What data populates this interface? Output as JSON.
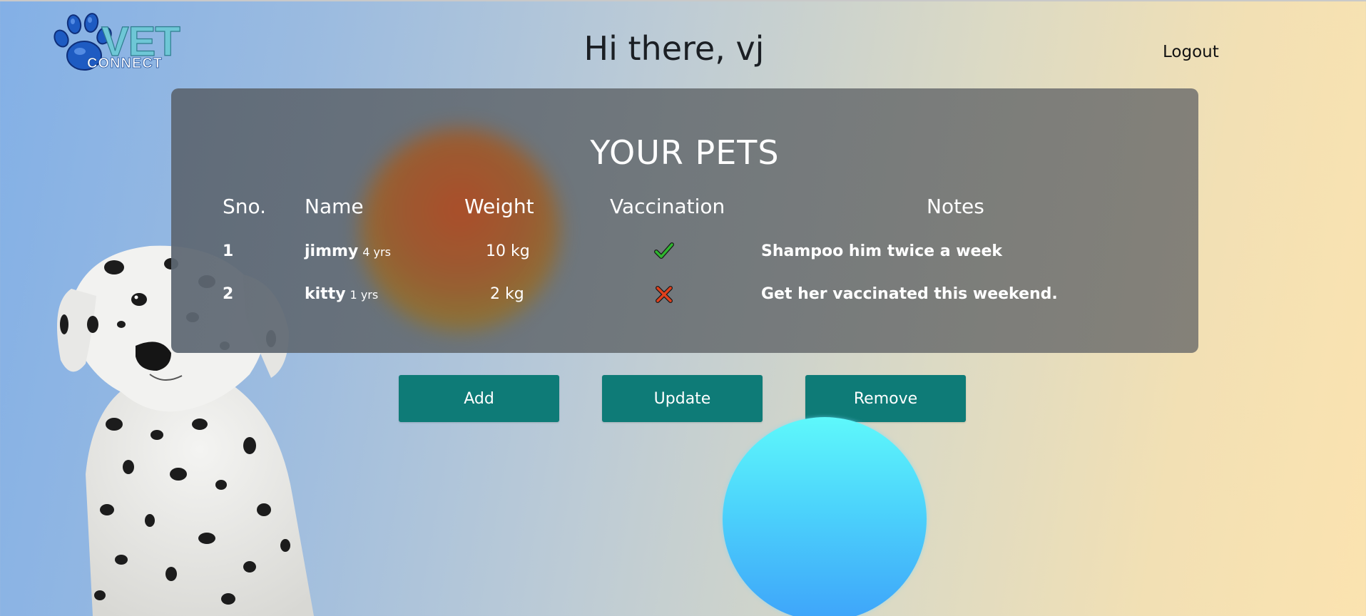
{
  "brand": {
    "logo_top": "VET",
    "logo_bottom": "CONNECT"
  },
  "header": {
    "greeting": "Hi there, vj",
    "logout_label": "Logout"
  },
  "pets_card": {
    "title": "YOUR PETS",
    "columns": [
      "Sno.",
      "Name",
      "Weight",
      "Vaccination",
      "Notes"
    ],
    "rows": [
      {
        "sno": "1",
        "name": "jimmy",
        "age": "4 yrs",
        "weight": "10 kg",
        "vaccinated": true,
        "vaccination_icon": "checkmark-icon",
        "notes": "Shampoo him twice a week"
      },
      {
        "sno": "2",
        "name": "kitty",
        "age": "1 yrs",
        "weight": "2 kg",
        "vaccinated": false,
        "vaccination_icon": "cross-icon",
        "notes": "Get her vaccinated this weekend."
      }
    ]
  },
  "actions": {
    "add_label": "Add",
    "update_label": "Update",
    "remove_label": "Remove"
  },
  "colors": {
    "button": "#0e7b77",
    "check": "#2fb52f",
    "cross": "#e0401c",
    "orb_cyan_top": "#5ef8fb",
    "orb_cyan_bottom": "#3ea4fa"
  }
}
